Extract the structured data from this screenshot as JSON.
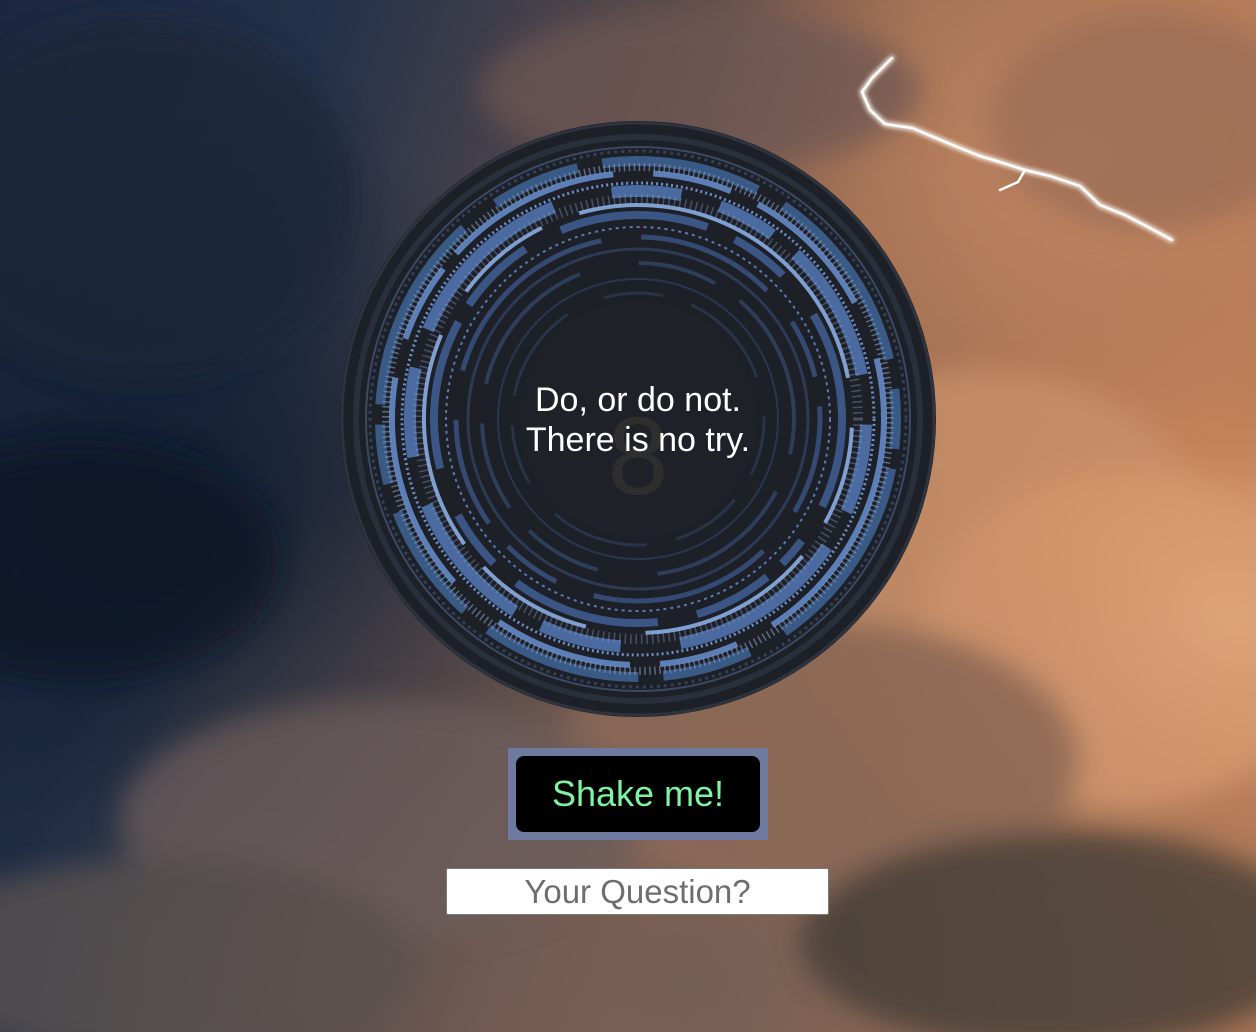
{
  "answer": {
    "line1": "Do, or do not.",
    "line2": "There is no try."
  },
  "ball": {
    "number": "8",
    "accent": "#4f7ec2"
  },
  "shake_button": {
    "label": "Shake me!",
    "text_color": "#7ef3a2",
    "frame_color": "#6f7aa1"
  },
  "question": {
    "placeholder": "Your Question?",
    "value": ""
  },
  "background": {
    "description_icon": "storm-clouds-lightning-background"
  }
}
